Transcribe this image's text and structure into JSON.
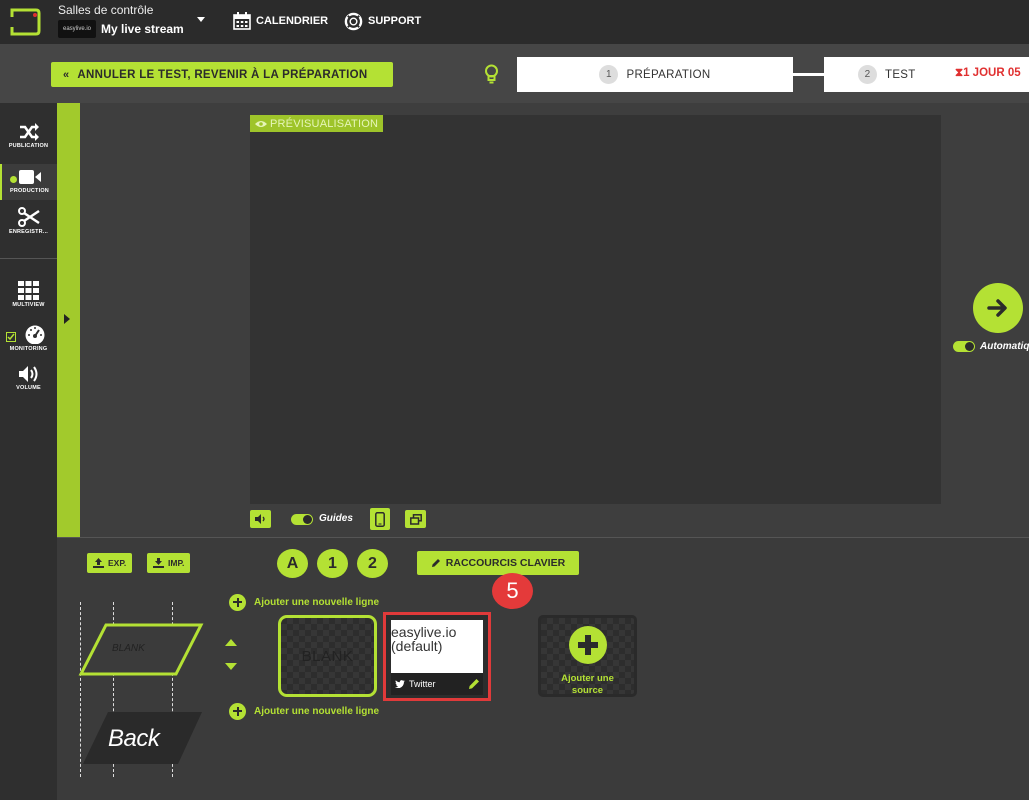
{
  "header": {
    "control_room": "Salles de contrôle",
    "stream_thumb": "easylive.io",
    "stream_name": "My live stream",
    "calendar": "CALENDRIER",
    "support": "SUPPORT"
  },
  "actions": {
    "cancel_test": "ANNULER LE TEST, REVENIR À LA PRÉPARATION",
    "steps": [
      {
        "num": "1",
        "label": "PRÉPARATION"
      },
      {
        "num": "2",
        "label": "TEST"
      }
    ],
    "timer": "1 JOUR 05"
  },
  "sidebar": {
    "items": [
      {
        "label": "PUBLICATION"
      },
      {
        "label": "PRODUCTION"
      },
      {
        "label": "ENREGISTR..."
      },
      {
        "label": "MULTIVIEW"
      },
      {
        "label": "MONITORING"
      },
      {
        "label": "VOLUME"
      }
    ]
  },
  "preview": {
    "tag": "PRÉVISUALISATION",
    "guides_label": "Guides",
    "auto_label": "Automatiq"
  },
  "bottom": {
    "export": "EXP.",
    "import": "IMP.",
    "scenes": [
      "A",
      "1",
      "2"
    ],
    "shortcuts": "RACCOURCIS CLAVIER",
    "badge": "5",
    "add_line": "Ajouter une nouvelle ligne",
    "diagram_top": "BLANK",
    "diagram_bottom": "Back",
    "blank_tile": "BLANK",
    "twitter_card": {
      "title_line1": "easylive.io",
      "title_line2": "(default)",
      "source": "Twitter"
    },
    "add_source": {
      "line1": "Ajouter une",
      "line2": "source"
    }
  },
  "colors": {
    "accent": "#b4e134",
    "highlight": "#e03a3a",
    "dark": "#2b2b2b"
  }
}
